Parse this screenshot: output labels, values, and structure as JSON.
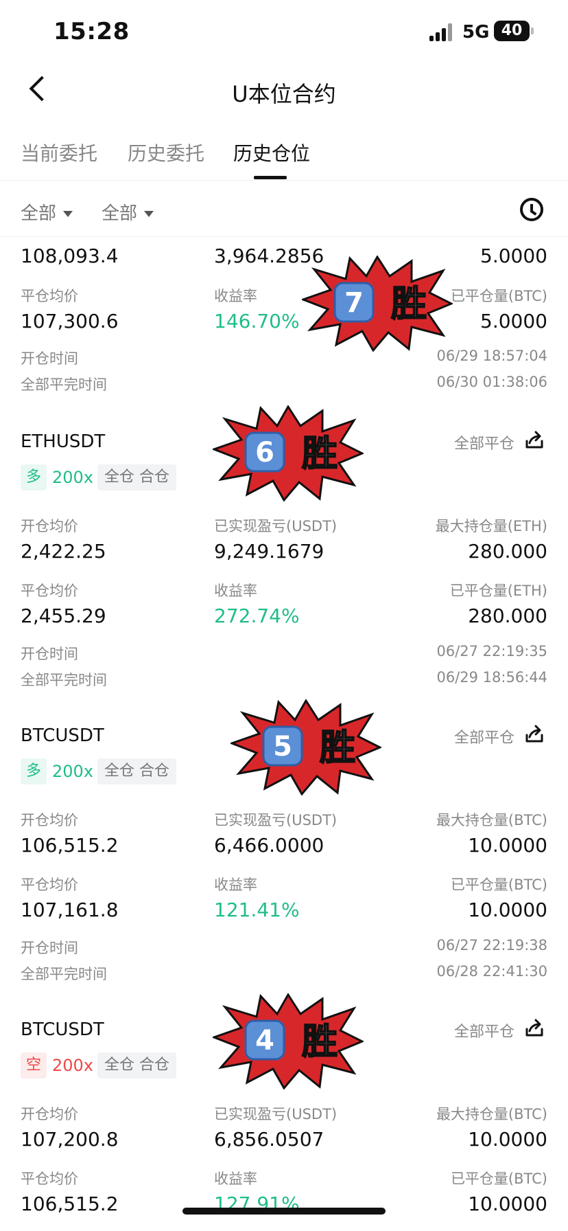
{
  "status_bar": {
    "time": "15:28",
    "network": "5G",
    "battery": "40"
  },
  "header": {
    "title": "U本位合约"
  },
  "tabs": [
    {
      "label": "当前委托",
      "active": false
    },
    {
      "label": "历史委托",
      "active": false
    },
    {
      "label": "历史仓位",
      "active": true
    }
  ],
  "filters": {
    "filter1": "全部",
    "filter2": "全部"
  },
  "top_partial": {
    "entry_price": "108,093.4",
    "pnl": "3,964.2856",
    "max_position": "5.0000",
    "close_price_label": "平仓均价",
    "close_price": "107,300.6",
    "roi_label": "收益率",
    "roi": "146.70%",
    "closed_qty_label": "已平仓量(BTC)",
    "closed_qty": "5.0000",
    "open_time_label": "开仓时间",
    "open_time": "06/29 18:57:04",
    "close_time_label": "全部平完时间",
    "close_time": "06/30 01:38:06",
    "sticker": {
      "number": "7",
      "text": "胜"
    }
  },
  "positions": [
    {
      "symbol": "ETHUSDT",
      "side": "多",
      "leverage": "200x",
      "mode": "全仓 合仓",
      "close_all": "全部平仓",
      "entry_label": "开仓均价",
      "entry_price": "2,422.25",
      "pnl_label": "已实现盈亏(USDT)",
      "pnl": "9,249.1679",
      "max_label": "最大持仓量(ETH)",
      "max_position": "280.000",
      "close_label": "平仓均价",
      "close_price": "2,455.29",
      "roi_label": "收益率",
      "roi": "272.74%",
      "closed_label": "已平仓量(ETH)",
      "closed_qty": "280.000",
      "open_time_label": "开仓时间",
      "open_time": "06/27 22:19:35",
      "close_time_label": "全部平完时间",
      "close_time": "06/29 18:56:44",
      "sticker": {
        "number": "6",
        "text": "胜"
      }
    },
    {
      "symbol": "BTCUSDT",
      "side": "多",
      "leverage": "200x",
      "mode": "全仓 合仓",
      "close_all": "全部平仓",
      "entry_label": "开仓均价",
      "entry_price": "106,515.2",
      "pnl_label": "已实现盈亏(USDT)",
      "pnl": "6,466.0000",
      "max_label": "最大持仓量(BTC)",
      "max_position": "10.0000",
      "close_label": "平仓均价",
      "close_price": "107,161.8",
      "roi_label": "收益率",
      "roi": "121.41%",
      "closed_label": "已平仓量(BTC)",
      "closed_qty": "10.0000",
      "open_time_label": "开仓时间",
      "open_time": "06/27 22:19:38",
      "close_time_label": "全部平完时间",
      "close_time": "06/28 22:41:30",
      "sticker": {
        "number": "5",
        "text": "胜"
      }
    },
    {
      "symbol": "BTCUSDT",
      "side": "空",
      "leverage": "200x",
      "mode": "全仓 合仓",
      "close_all": "全部平仓",
      "entry_label": "开仓均价",
      "entry_price": "107,200.8",
      "pnl_label": "已实现盈亏(USDT)",
      "pnl": "6,856.0507",
      "max_label": "最大持仓量(BTC)",
      "max_position": "10.0000",
      "close_label": "平仓均价",
      "close_price": "106,515.2",
      "roi_label": "收益率",
      "roi": "127.91%",
      "closed_label": "已平仓量(BTC)",
      "closed_qty": "10.0000",
      "sticker": {
        "number": "4",
        "text": "胜"
      }
    }
  ],
  "colors": {
    "profit": "#1fbd8a",
    "loss": "#f04848",
    "sticker_red": "#d8272a"
  }
}
